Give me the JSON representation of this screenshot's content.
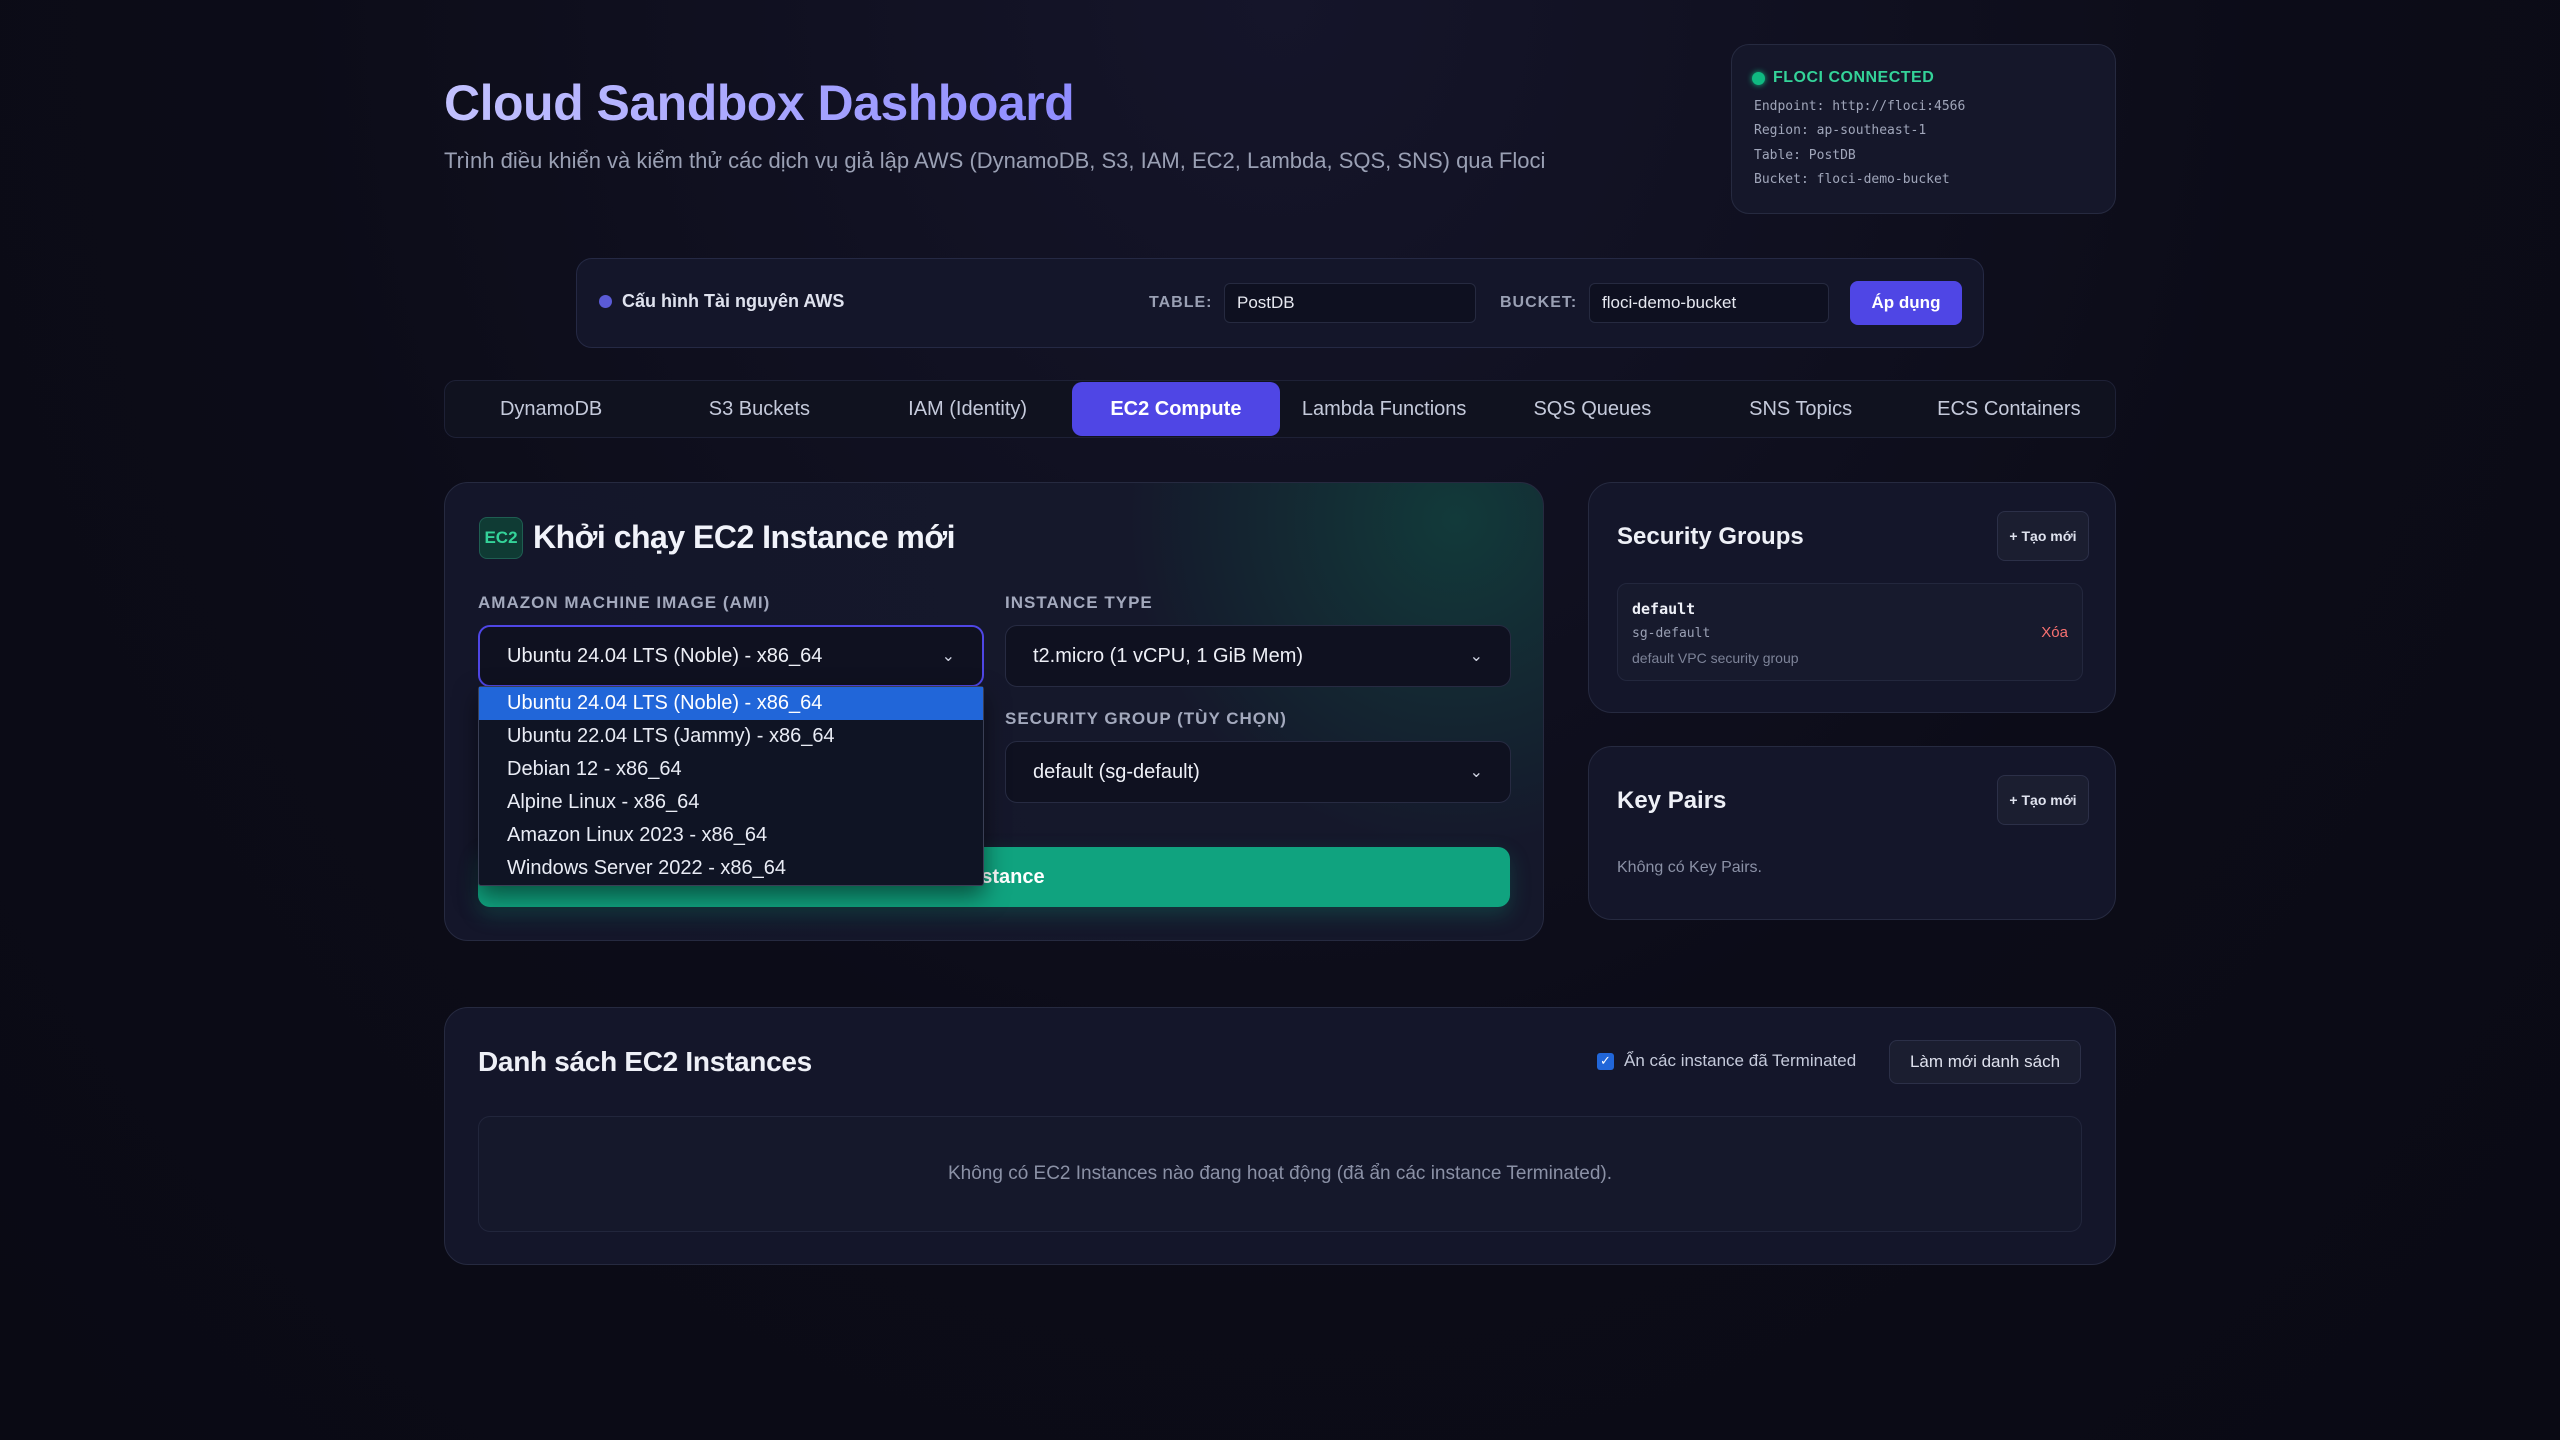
{
  "header": {
    "title": "Cloud Sandbox Dashboard",
    "subtitle": "Trình điều khiển và kiểm thử các dịch vụ giả lập AWS (DynamoDB, S3, IAM, EC2, Lambda, SQS, SNS) qua Floci"
  },
  "connection": {
    "status": "FLOCI CONNECTED",
    "endpoint": "Endpoint: http://floci:4566",
    "region": "Region: ap-southeast-1",
    "table": "Table: PostDB",
    "bucket": "Bucket: floci-demo-bucket",
    "status_color": "#10b981"
  },
  "config": {
    "label": "Cấu hình Tài nguyên AWS",
    "table_label": "TABLE:",
    "table_value": "PostDB",
    "bucket_label": "BUCKET:",
    "bucket_value": "floci-demo-bucket",
    "apply_label": "Áp dụng"
  },
  "tabs": [
    {
      "label": "DynamoDB",
      "active": false
    },
    {
      "label": "S3 Buckets",
      "active": false
    },
    {
      "label": "IAM (Identity)",
      "active": false
    },
    {
      "label": "EC2 Compute",
      "active": true
    },
    {
      "label": "Lambda Functions",
      "active": false
    },
    {
      "label": "SQS Queues",
      "active": false
    },
    {
      "label": "SNS Topics",
      "active": false
    },
    {
      "label": "ECS Containers",
      "active": false
    }
  ],
  "launch": {
    "badge": "EC2",
    "title": "Khởi chạy EC2 Instance mới",
    "ami_label": "AMAZON MACHINE IMAGE (AMI)",
    "ami_selected": "Ubuntu 24.04 LTS (Noble) - x86_64",
    "ami_options": [
      "Ubuntu 24.04 LTS (Noble) - x86_64",
      "Ubuntu 22.04 LTS (Jammy) - x86_64",
      "Debian 12 - x86_64",
      "Alpine Linux - x86_64",
      "Amazon Linux 2023 - x86_64",
      "Windows Server 2022 - x86_64"
    ],
    "instance_type_label": "INSTANCE TYPE",
    "instance_type_value": "t2.micro (1 vCPU, 1 GiB Mem)",
    "sg_label": "SECURITY GROUP (TÙY CHỌN)",
    "sg_value": "default (sg-default)",
    "launch_btn_visible": "Instance",
    "accent": "#10a37f"
  },
  "security_groups": {
    "title": "Security Groups",
    "new_label": "+ Tạo mới",
    "items": [
      {
        "name": "default",
        "id": "sg-default",
        "desc": "default VPC security group",
        "delete_label": "Xóa"
      }
    ]
  },
  "key_pairs": {
    "title": "Key Pairs",
    "new_label": "+ Tạo mới",
    "empty": "Không có Key Pairs."
  },
  "instances": {
    "title": "Danh sách EC2 Instances",
    "hide_terminated_label": "Ẩn các instance đã Terminated",
    "hide_terminated_checked": true,
    "refresh_label": "Làm mới danh sách",
    "empty": "Không có EC2 Instances nào đang hoạt động (đã ẩn các instance Terminated)."
  }
}
